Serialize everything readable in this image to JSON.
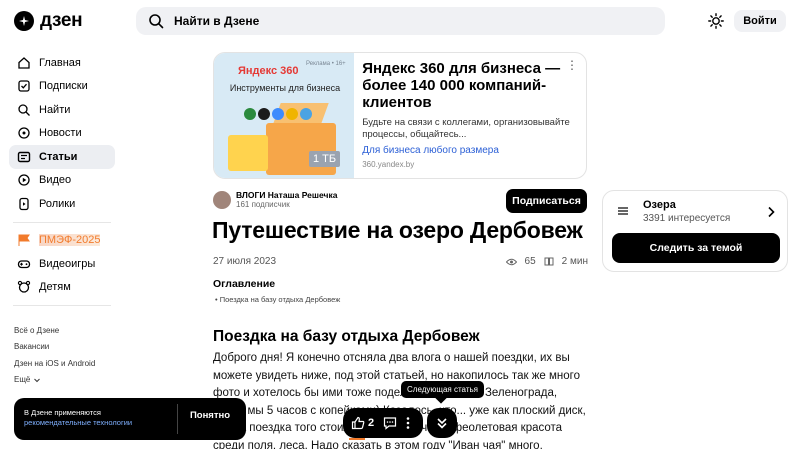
{
  "header": {
    "logo_text": "дзен",
    "search_placeholder": "Найти в Дзене",
    "login_label": "Войти"
  },
  "sidebar": {
    "items": [
      {
        "label": "Главная",
        "icon": "home-icon"
      },
      {
        "label": "Подписки",
        "icon": "subscriptions-icon"
      },
      {
        "label": "Найти",
        "icon": "search-icon"
      },
      {
        "label": "Новости",
        "icon": "news-icon"
      },
      {
        "label": "Статьи",
        "icon": "articles-icon",
        "active": true
      },
      {
        "label": "Видео",
        "icon": "video-icon"
      },
      {
        "label": "Ролики",
        "icon": "clips-icon"
      }
    ],
    "promo": {
      "label": "ПМЭФ-2025",
      "icon": "flag-icon",
      "color": "#f27b2c"
    },
    "items2": [
      {
        "label": "Видеоигры",
        "icon": "gamepad-icon"
      },
      {
        "label": "Детям",
        "icon": "kids-icon"
      }
    ],
    "footer_links": [
      "Всё о Дзене",
      "Вакансии",
      "Дзен на iOS и Android",
      "Ещё"
    ]
  },
  "ad": {
    "image_brand": "Яндекс 360",
    "image_age": "Реклама • 16+",
    "image_title": "Инструменты для бизнеса",
    "image_badge": "1 ТБ",
    "title": "Яндекс 360 для бизнеса — более 140 000 компаний-клиентов",
    "description": "Будьте на связи с коллегами, организовывайте процессы, общайтесь...",
    "link": "Для бизнеса любого размера",
    "domain": "360.yandex.by"
  },
  "channel": {
    "name": "ВЛОГИ Наташа Решечка",
    "subscribers": "161 подписчик",
    "subscribe_label": "Подписаться"
  },
  "article": {
    "title": "Путешествие на озеро Дербовеж",
    "date": "27 июля 2023",
    "views": "65",
    "read_time": "2 мин",
    "toc_title": "Оглавление",
    "toc_items": [
      "Поездка на базу отдыха Дербовеж"
    ],
    "section_title": "Поездка на базу отдыха Дербовеж",
    "body": "Доброго дня! Я конечно отсняла два влога о нашей поездки, их вы можете увидеть ниже, под этой статьей, но накопилось так же много фото и хотелось бы ими тоже поделиться! На... из Зеленограда, ехали мы 5 часов с копейками) Казалось, что... уже как плоский диск, но эта поездка того стоила)))) ...«Иван чая», феолетовая красота среди поля, леса. Надо сказать в этом году \"Иван чая\" много,"
  },
  "topic": {
    "name": "Озера",
    "count": "3391 интересуется",
    "follow_label": "Следить за темой"
  },
  "cookie": {
    "text": "В Дзене применяются",
    "link": "рекомендательные технологии",
    "button": "Понятно"
  },
  "floating": {
    "likes": "2",
    "tooltip": "Следующая статья"
  }
}
